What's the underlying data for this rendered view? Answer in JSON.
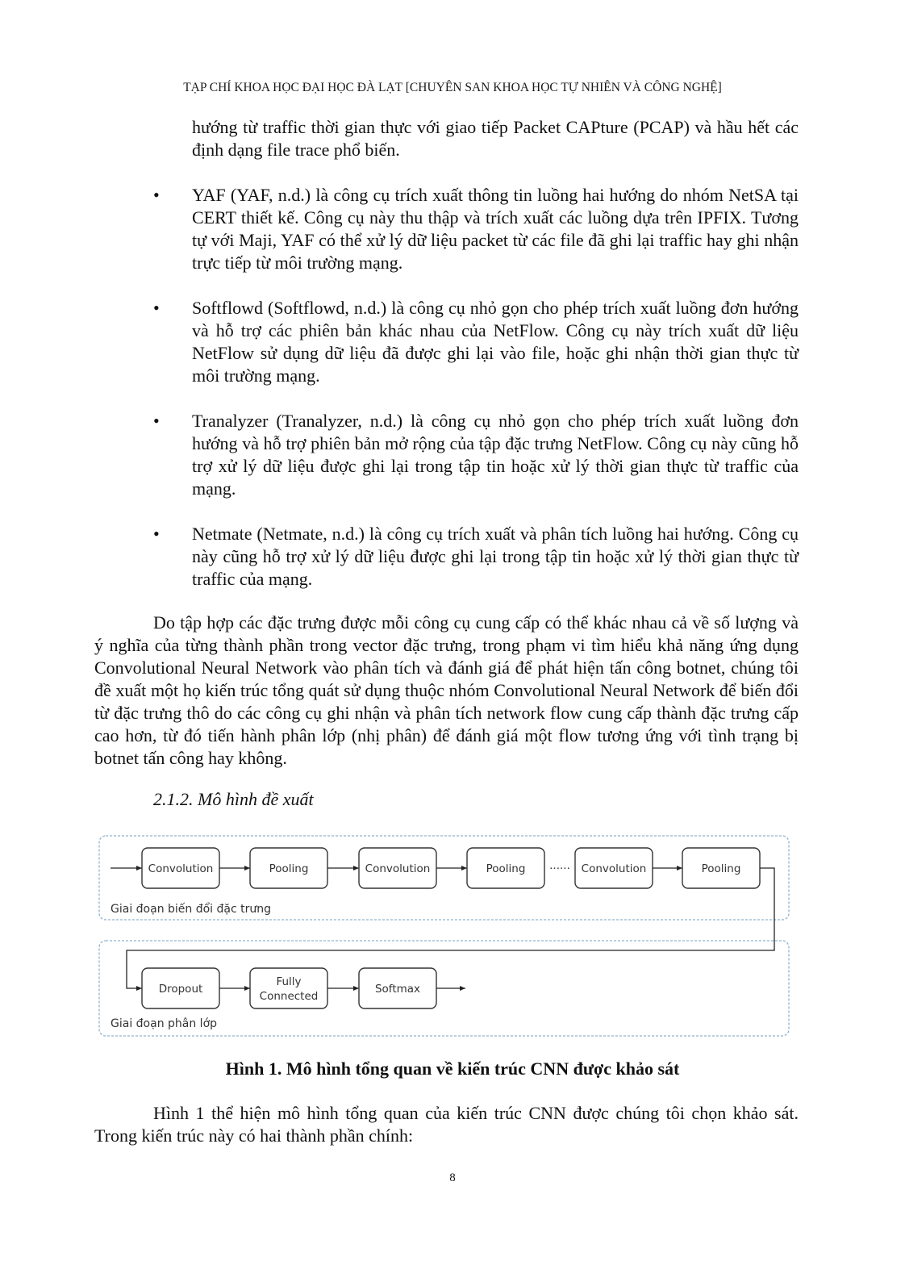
{
  "header": "TẠP CHÍ KHOA HỌC ĐẠI HỌC ĐÀ LẠT [CHUYÊN SAN KHOA HỌC TỰ NHIÊN VÀ CÔNG NGHỆ]",
  "continuation": "hướng từ traffic thời gian thực với giao tiếp Packet CAPture (PCAP) và hầu hết các định dạng file trace phổ biến.",
  "bullets": [
    {
      "marker": "•",
      "text": "YAF (YAF, n.d.) là công cụ trích xuất thông tin luồng hai hướng do nhóm NetSA tại CERT thiết kế. Công cụ này thu thập và trích xuất các luồng dựa trên IPFIX. Tương tự với Maji, YAF có thể xử lý dữ liệu packet từ các file đã ghi lại traffic hay ghi nhận trực tiếp từ môi trường mạng."
    },
    {
      "marker": "•",
      "text": "Softflowd (Softflowd, n.d.) là công cụ nhỏ gọn cho phép trích xuất luồng đơn hướng và hỗ trợ các phiên bản khác nhau của NetFlow. Công cụ này trích xuất dữ liệu NetFlow sử dụng dữ liệu đã được ghi lại vào file, hoặc ghi nhận thời gian thực từ môi trường mạng."
    },
    {
      "marker": "•",
      "text": "Tranalyzer (Tranalyzer, n.d.) là công cụ nhỏ gọn cho phép trích xuất luồng đơn hướng và hỗ trợ phiên bản mở rộng của tập đặc trưng NetFlow. Công cụ này cũng hỗ trợ xử lý dữ liệu được ghi lại trong tập tin hoặc xử lý thời gian thực từ traffic của mạng."
    },
    {
      "marker": "•",
      "text": "Netmate  (Netmate, n.d.) là công cụ trích xuất và phân tích luồng hai hướng. Công cụ này cũng hỗ trợ xử lý dữ liệu được ghi lại trong tập tin hoặc xử lý thời gian thực từ traffic của mạng."
    }
  ],
  "paragraph1": "Do tập hợp các đặc trưng được mỗi công cụ cung cấp có thể khác nhau cả về số lượng và ý nghĩa của từng thành phần trong vector đặc trưng, trong phạm vi tìm hiểu khả năng ứng dụng Convolutional Neural Network vào phân tích và đánh giá để phát hiện tấn công botnet, chúng tôi đề xuất một họ kiến trúc tổng quát sử dụng thuộc nhóm Convolutional Neural Network để biến đổi từ đặc trưng thô do các công cụ ghi nhận và phân tích network flow cung cấp thành đặc trưng cấp cao hơn, từ đó tiến hành phân lớp (nhị phân) để đánh giá một flow tương ứng với tình trạng bị botnet tấn công hay không.",
  "subheading": "2.1.2. Mô hình đề xuất",
  "figure": {
    "stage1": {
      "label": "Giai đoạn biến đổi đặc trưng",
      "nodes": [
        "Convolution",
        "Pooling",
        "Convolution",
        "Pooling",
        "Convolution",
        "Pooling"
      ],
      "ellipsis": "......"
    },
    "stage2": {
      "label": "Giai đoạn phân lớp",
      "nodes": [
        "Dropout",
        "Fully\nConnected",
        "Softmax"
      ]
    },
    "colors": {
      "dashed_border": "#8fb3cf",
      "node_border": "#333333",
      "arrow": "#222222"
    }
  },
  "caption": "Hình 1. Mô hình tổng quan về kiến trúc CNN được khảo sát",
  "paragraph2": "Hình 1 thể hiện mô hình tổng quan của kiến trúc CNN được chúng tôi chọn khảo sát. Trong kiến trúc này có hai thành phần chính:",
  "page_number": "8"
}
